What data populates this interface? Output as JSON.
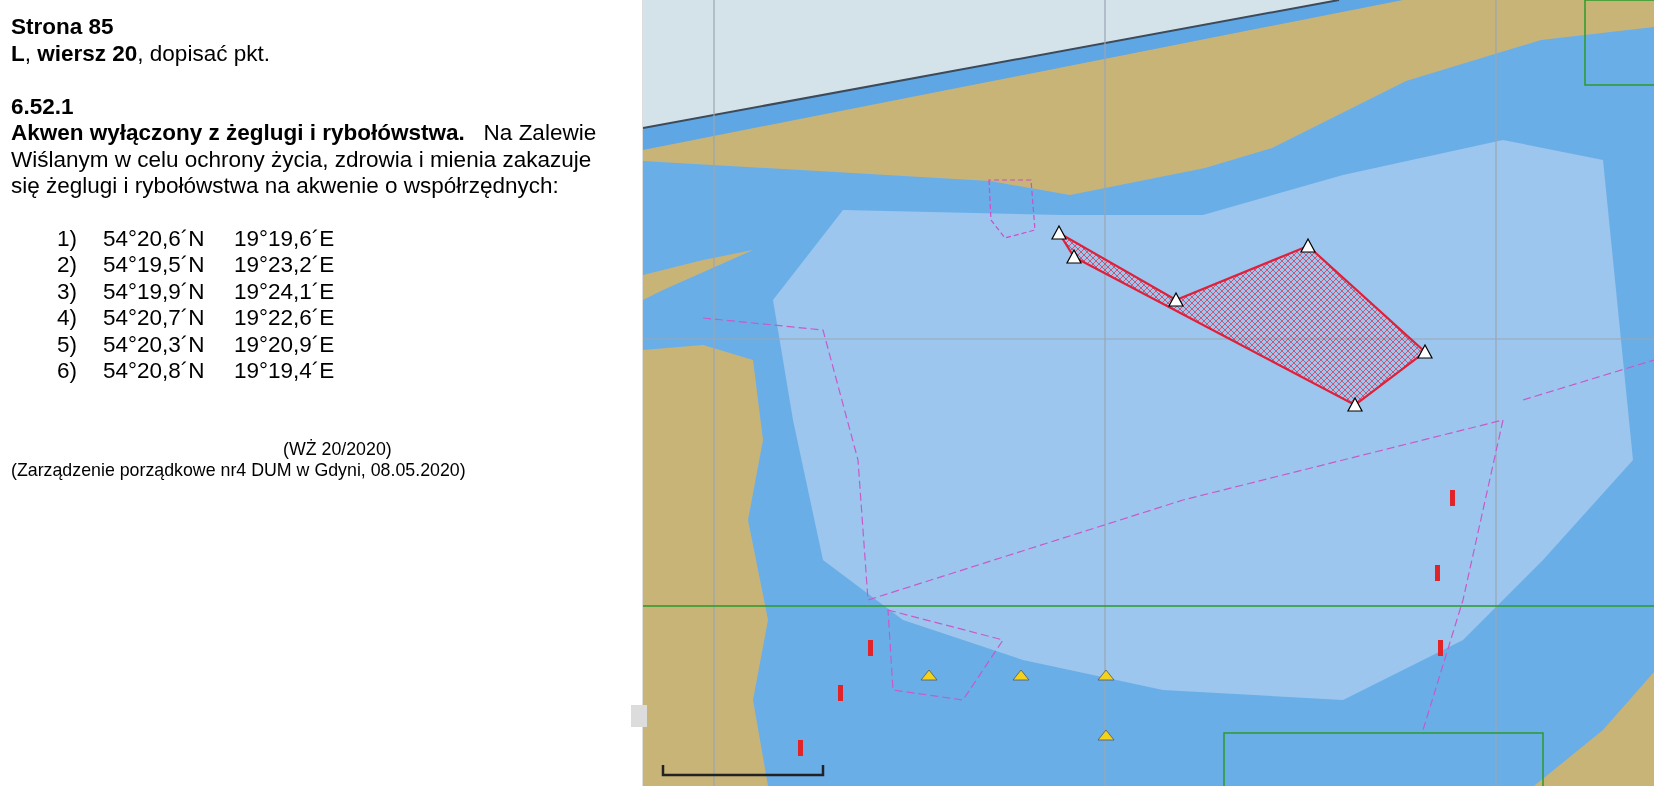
{
  "page_heading": "Strona 85",
  "amendment": "**L**, **wiersz 20**, dopisać pkt.",
  "section_number": "6.52.1",
  "paragraph": "**Akwen wyłączony z żeglugi i rybołówstwa.**   Na Zalewie Wiślanym w celu ochrony życia, zdrowia i mienia zakazuje się żeglugi i rybołówstwa na akwenie o współrzędnych:",
  "coordinates": [
    {
      "number": "1)",
      "latitude": "54°20,6´N",
      "longitude": "19°19,6´E"
    },
    {
      "number": "2)",
      "latitude": "54°19,5´N",
      "longitude": "19°23,2´E"
    },
    {
      "number": "3)",
      "latitude": "54°19,9´N",
      "longitude": "19°24,1´E"
    },
    {
      "number": "4)",
      "latitude": "54°20,7´N",
      "longitude": "19°22,6´E"
    },
    {
      "number": "5)",
      "latitude": "54°20,3´N",
      "longitude": "19°20,9´E"
    },
    {
      "number": "6)",
      "latitude": "54°20,8´N",
      "longitude": "19°19,4´E"
    }
  ],
  "reference": "(WŻ 20/2020)",
  "source": "(Zarządzenie porządkowe nr4 DUM w Gdyni, 08.05.2020)"
}
